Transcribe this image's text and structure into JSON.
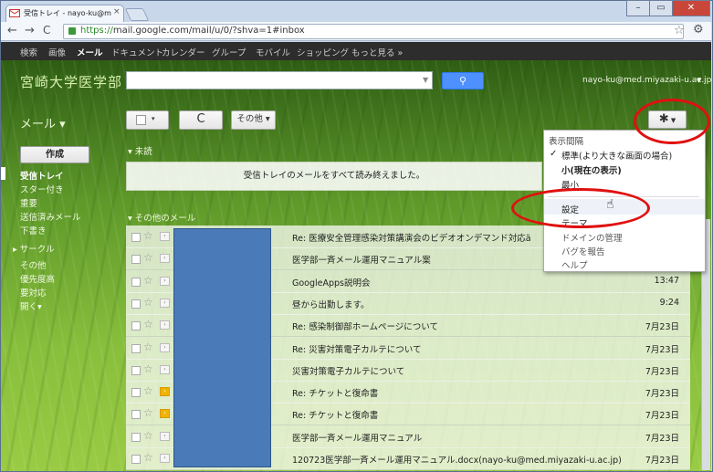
{
  "browser": {
    "tab_title": "受信トレイ - nayo-ku@med...",
    "tab_close": "×",
    "url_scheme": "https://",
    "url_rest": "mail.google.com/mail/u/0/?shva=1#inbox",
    "nav": {
      "back": "←",
      "forward": "→",
      "reload": "C"
    },
    "star_icon": "☆",
    "wrench_icon": "🔧",
    "window_buttons": [
      "–",
      "▭",
      "✕"
    ]
  },
  "gbar": {
    "items": [
      "検索",
      "画像",
      "メール",
      "ドキュメント",
      "カレンダー",
      "グループ",
      "モバイル",
      "ショッピング",
      "もっと見る »"
    ]
  },
  "header": {
    "logo": "宮崎大学医学部",
    "search_button": "🔍",
    "account": "nayo-ku@med.miyazaki-u.ac.jp"
  },
  "toolbar": {
    "mail_label": "メール ▾",
    "select_arrow": "▾",
    "refresh": "C",
    "more": "その他 ▾",
    "gear": "✱ ▾"
  },
  "sidebar": {
    "compose": "作成",
    "items": [
      "受信トレイ",
      "スター付き",
      "重要",
      "送信済みメール",
      "下書き",
      "▸ サークル",
      "その他",
      "優先度高",
      "要対応",
      "開く▾"
    ]
  },
  "sections": {
    "unread": "▾ 未読",
    "all_read_message": "受信トレイのメールをすべて読み終えました。",
    "other": "▾ その他のメール"
  },
  "emails": [
    {
      "subject": "Re: 医療安全管理感染対策講演会のビデオオンデマンド対応ä",
      "date": "",
      "important": false
    },
    {
      "subject": "医学部一斉メール運用マニュアル案",
      "date": "",
      "important": false
    },
    {
      "subject": "GoogleApps説明会",
      "date": "13:47",
      "important": false
    },
    {
      "subject": "昼から出勤します。",
      "date": "9:24",
      "important": false
    },
    {
      "subject": "Re: 感染制御部ホームページについて",
      "date": "7月23日",
      "important": false
    },
    {
      "subject": "Re: 災害対策電子カルテについて",
      "date": "7月23日",
      "important": false
    },
    {
      "subject": "災害対策電子カルテについて",
      "date": "7月23日",
      "important": false
    },
    {
      "subject": "Re: チケットと復命書",
      "date": "7月23日",
      "important": true
    },
    {
      "subject": "Re: チケットと復命書",
      "date": "7月23日",
      "important": true
    },
    {
      "subject": "医学部一斉メール運用マニュアル",
      "date": "7月23日",
      "important": false
    },
    {
      "subject": "120723医学部一斉メール運用マニュアル.docx(nayo-ku@med.miyazaki-u.ac.jp)",
      "date": "7月23日",
      "important": false
    }
  ],
  "settings_menu": {
    "heading": "表示間隔",
    "density_default": "標準(より大きな画面の場合)",
    "density_compact": "小(現在の表示)",
    "density_min": "最小",
    "settings": "設定",
    "themes": "テーマ",
    "domain": "ドメインの管理",
    "report_bug": "バグを報告",
    "help": "ヘルプ"
  },
  "colors": {
    "annotation": "#e01010",
    "search_button": "#4d90fe",
    "important_marker": "#f0b400"
  }
}
